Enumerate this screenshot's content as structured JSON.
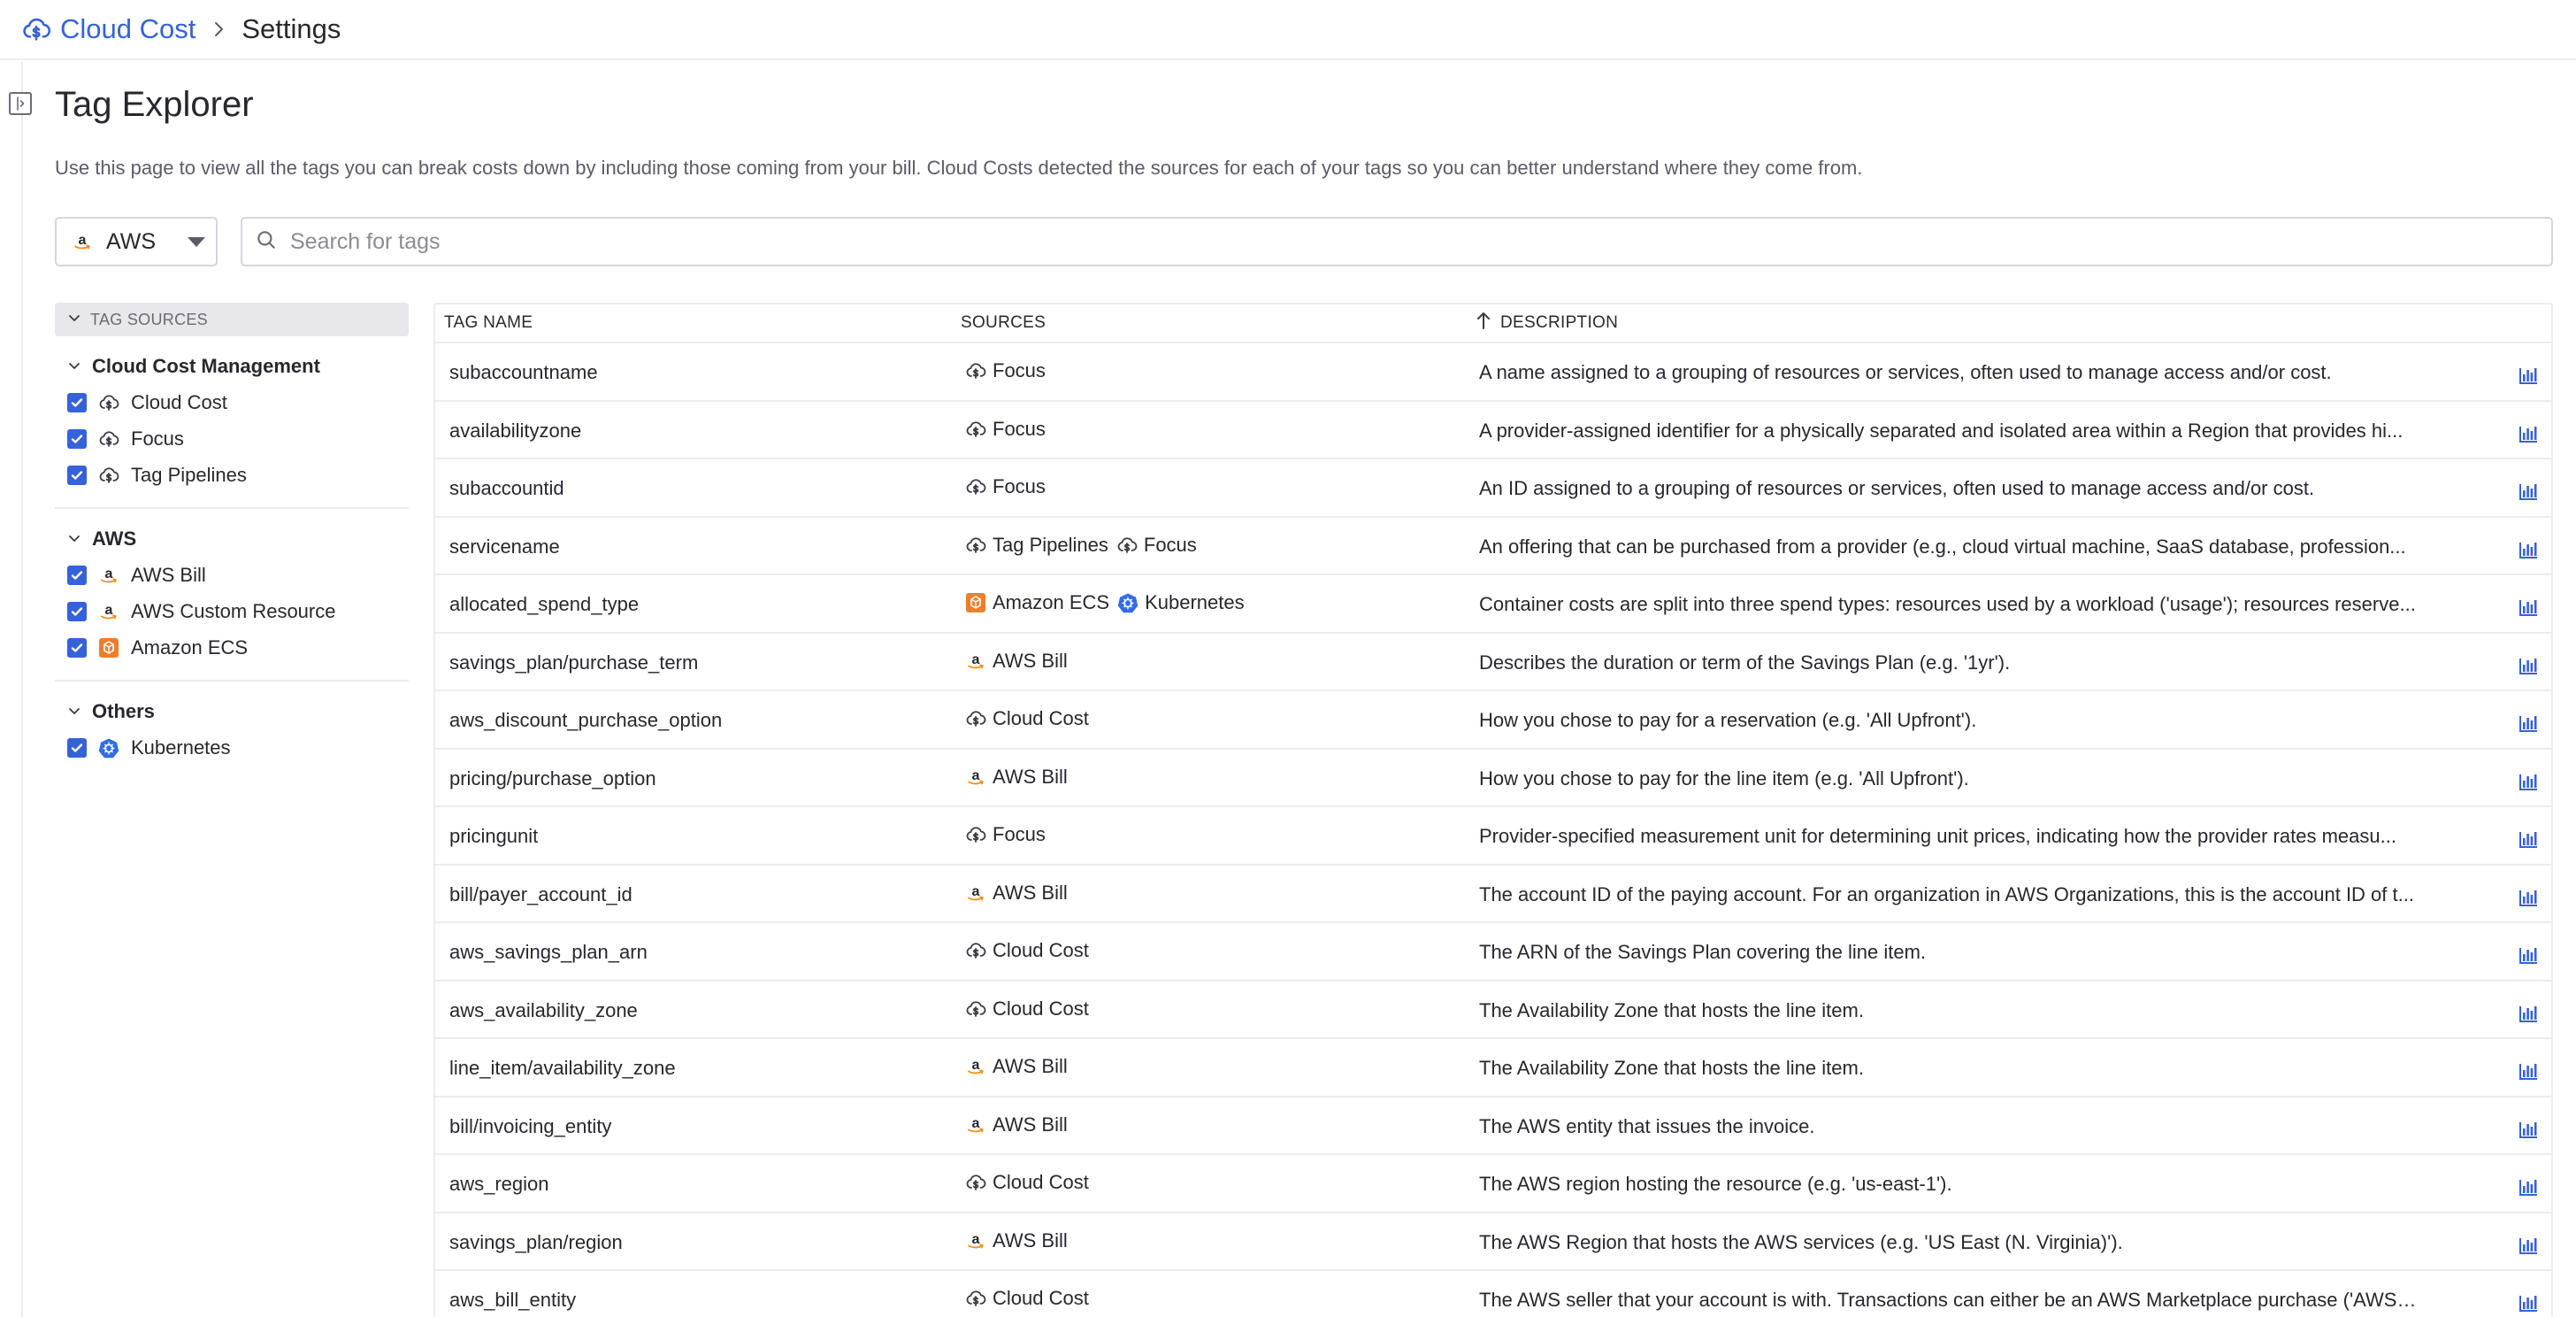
{
  "header": {
    "product": "Cloud Cost",
    "current": "Settings"
  },
  "page": {
    "title": "Tag Explorer",
    "description": "Use this page to view all the tags you can break costs down by including those coming from your bill. Cloud Costs detected the sources for each of your tags so you can better understand where they come from."
  },
  "controls": {
    "provider": "AWS",
    "search_placeholder": "Search for tags"
  },
  "sidebar": {
    "header": "TAG SOURCES",
    "groups": [
      {
        "title": "Cloud Cost Management",
        "items": [
          {
            "label": "Cloud Cost",
            "icon": "cloud-cost-icon",
            "checked": true
          },
          {
            "label": "Focus",
            "icon": "cloud-cost-icon",
            "checked": true
          },
          {
            "label": "Tag Pipelines",
            "icon": "cloud-cost-icon",
            "checked": true
          }
        ]
      },
      {
        "title": "AWS",
        "items": [
          {
            "label": "AWS Bill",
            "icon": "amazon-icon",
            "checked": true
          },
          {
            "label": "AWS Custom Resource",
            "icon": "amazon-icon",
            "checked": true
          },
          {
            "label": "Amazon ECS",
            "icon": "amazon-ecs-icon",
            "checked": true
          }
        ]
      },
      {
        "title": "Others",
        "items": [
          {
            "label": "Kubernetes",
            "icon": "kubernetes-icon",
            "checked": true
          }
        ]
      }
    ]
  },
  "table": {
    "columns": {
      "name": "TAG NAME",
      "sources": "SOURCES",
      "description": "DESCRIPTION"
    },
    "sort": {
      "column": "description",
      "direction": "ascending"
    },
    "rows": [
      {
        "name": "subaccountname",
        "sources": [
          {
            "label": "Focus",
            "icon": "cloud-cost-icon"
          }
        ],
        "description": "A name assigned to a grouping of resources or services, often used to manage access and/or cost."
      },
      {
        "name": "availabilityzone",
        "sources": [
          {
            "label": "Focus",
            "icon": "cloud-cost-icon"
          }
        ],
        "description": "A provider-assigned identifier for a physically separated and isolated area within a Region that provides hi..."
      },
      {
        "name": "subaccountid",
        "sources": [
          {
            "label": "Focus",
            "icon": "cloud-cost-icon"
          }
        ],
        "description": "An ID assigned to a grouping of resources or services, often used to manage access and/or cost."
      },
      {
        "name": "servicename",
        "sources": [
          {
            "label": "Tag Pipelines",
            "icon": "cloud-cost-icon"
          },
          {
            "label": "Focus",
            "icon": "cloud-cost-icon"
          }
        ],
        "description": "An offering that can be purchased from a provider (e.g., cloud virtual machine, SaaS database, profession..."
      },
      {
        "name": "allocated_spend_type",
        "sources": [
          {
            "label": "Amazon ECS",
            "icon": "amazon-ecs-icon"
          },
          {
            "label": "Kubernetes",
            "icon": "kubernetes-icon"
          }
        ],
        "description": "Container costs are split into three spend types: resources used by a workload ('usage'); resources reserve..."
      },
      {
        "name": "savings_plan/purchase_term",
        "sources": [
          {
            "label": "AWS Bill",
            "icon": "amazon-icon"
          }
        ],
        "description": "Describes the duration or term of the Savings Plan (e.g. '1yr')."
      },
      {
        "name": "aws_discount_purchase_option",
        "sources": [
          {
            "label": "Cloud Cost",
            "icon": "cloud-cost-icon"
          }
        ],
        "description": "How you chose to pay for a reservation (e.g. 'All Upfront')."
      },
      {
        "name": "pricing/purchase_option",
        "sources": [
          {
            "label": "AWS Bill",
            "icon": "amazon-icon"
          }
        ],
        "description": "How you chose to pay for the line item (e.g. 'All Upfront')."
      },
      {
        "name": "pricingunit",
        "sources": [
          {
            "label": "Focus",
            "icon": "cloud-cost-icon"
          }
        ],
        "description": "Provider-specified measurement unit for determining unit prices, indicating how the provider rates measu..."
      },
      {
        "name": "bill/payer_account_id",
        "sources": [
          {
            "label": "AWS Bill",
            "icon": "amazon-icon"
          }
        ],
        "description": "The account ID of the paying account. For an organization in AWS Organizations, this is the account ID of t..."
      },
      {
        "name": "aws_savings_plan_arn",
        "sources": [
          {
            "label": "Cloud Cost",
            "icon": "cloud-cost-icon"
          }
        ],
        "description": "The ARN of the Savings Plan covering the line item."
      },
      {
        "name": "aws_availability_zone",
        "sources": [
          {
            "label": "Cloud Cost",
            "icon": "cloud-cost-icon"
          }
        ],
        "description": "The Availability Zone that hosts the line item."
      },
      {
        "name": "line_item/availability_zone",
        "sources": [
          {
            "label": "AWS Bill",
            "icon": "amazon-icon"
          }
        ],
        "description": "The Availability Zone that hosts the line item."
      },
      {
        "name": "bill/invoicing_entity",
        "sources": [
          {
            "label": "AWS Bill",
            "icon": "amazon-icon"
          }
        ],
        "description": "The AWS entity that issues the invoice."
      },
      {
        "name": "aws_region",
        "sources": [
          {
            "label": "Cloud Cost",
            "icon": "cloud-cost-icon"
          }
        ],
        "description": "The AWS region hosting the resource (e.g. 'us-east-1')."
      },
      {
        "name": "savings_plan/region",
        "sources": [
          {
            "label": "AWS Bill",
            "icon": "amazon-icon"
          }
        ],
        "description": "The AWS Region that hosts the AWS services (e.g. 'US East (N. Virginia)')."
      },
      {
        "name": "aws_bill_entity",
        "sources": [
          {
            "label": "Cloud Cost",
            "icon": "cloud-cost-icon"
          }
        ],
        "description": "The AWS seller that your account is with. Transactions can either be an AWS Marketplace purchase ('AWS ..."
      }
    ]
  },
  "colors": {
    "accent": "#3562d6",
    "ecs": "#ee7e2c",
    "kubernetes": "#326ce5"
  }
}
